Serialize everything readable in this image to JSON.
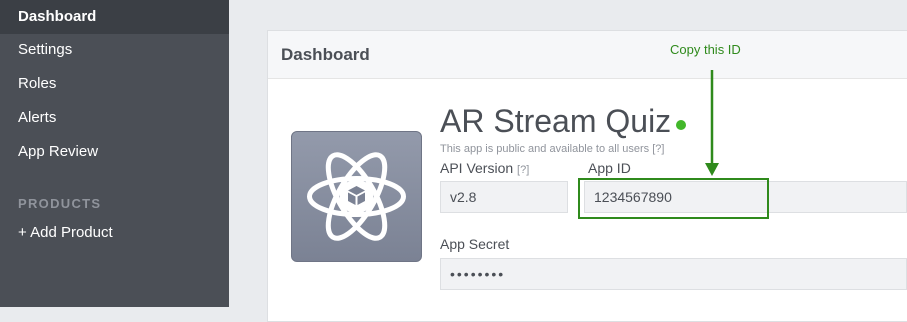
{
  "sidebar": {
    "items": [
      {
        "label": "Dashboard",
        "active": true
      },
      {
        "label": "Settings"
      },
      {
        "label": "Roles"
      },
      {
        "label": "Alerts"
      },
      {
        "label": "App Review"
      }
    ],
    "section_heading": "PRODUCTS",
    "add_product_label": "+ Add Product"
  },
  "card": {
    "title": "Dashboard"
  },
  "app": {
    "name": "AR Stream Quiz",
    "status_subtitle": "This app is public and available to all users",
    "help_marker": "[?]",
    "icon": "atom-cube-icon",
    "status_color": "#42b72a"
  },
  "fields": {
    "api_version": {
      "label": "API Version",
      "help": "[?]",
      "value": "v2.8"
    },
    "app_id": {
      "label": "App ID",
      "value": "1234567890"
    },
    "app_secret": {
      "label": "App Secret",
      "value": "••••••••"
    }
  },
  "annotation": {
    "text": "Copy this ID",
    "color": "#2f8a1c"
  }
}
